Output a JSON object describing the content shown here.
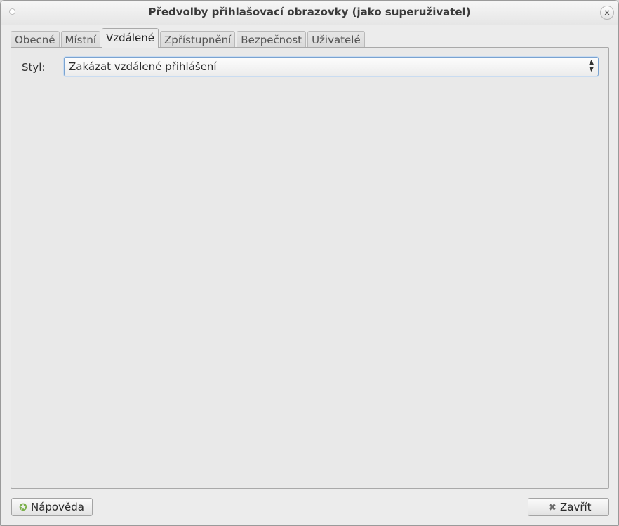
{
  "window": {
    "title": "Předvolby přihlašovací obrazovky (jako superuživatel)",
    "close_symbol": "×"
  },
  "tabs": [
    {
      "label": "Obecné",
      "active": false
    },
    {
      "label": "Místní",
      "active": false
    },
    {
      "label": "Vzdálené",
      "active": true
    },
    {
      "label": "Zpřístupnění",
      "active": false
    },
    {
      "label": "Bezpečnost",
      "active": false
    },
    {
      "label": "Uživatelé",
      "active": false
    }
  ],
  "remote": {
    "style_label": "Styl:",
    "style_value": "Zakázat vzdálené přihlášení"
  },
  "buttons": {
    "help_label": "Nápověda",
    "close_label": "Zavřít"
  },
  "icons": {
    "window_menu": "window-menu-icon",
    "help": "help-lifebuoy-icon",
    "close": "close-x-icon"
  }
}
